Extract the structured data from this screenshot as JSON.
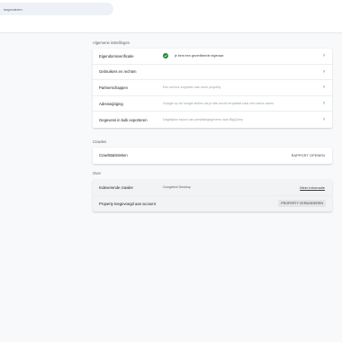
{
  "search": {
    "placeholder": "inspecteren"
  },
  "general": {
    "title": "Algemene instellingen",
    "rows": [
      {
        "label": "Eigendomsverificatie",
        "desc": "je bent een geverifieerde eigenaar"
      },
      {
        "label": "Gebruikers en rechten",
        "desc": ""
      },
      {
        "label": "Partnerschappen",
        "desc": "Een service koppelen aan deze property"
      },
      {
        "label": "Adreswijziging",
        "desc": "Google op de hoogte stellen als je site wordt verplaatst naar een nieuw adres"
      },
      {
        "label": "Gegevens in bulk exporteren",
        "desc": "Dagelijkse export van prestatiegegevens naar BigQuery"
      }
    ]
  },
  "crawl": {
    "title": "Crawlen",
    "row": {
      "label": "Crawlstatistieken",
      "action": "RAPPORT OPENEN"
    }
  },
  "about": {
    "title": "Over",
    "crawler": {
      "label": "Indexerende crawler",
      "value": "Googlebot Desktop",
      "link": "Meer informatie"
    },
    "added": {
      "label": "Property toegevoegd aan account",
      "action": "PROPERTY VERWIJDEREN"
    }
  }
}
